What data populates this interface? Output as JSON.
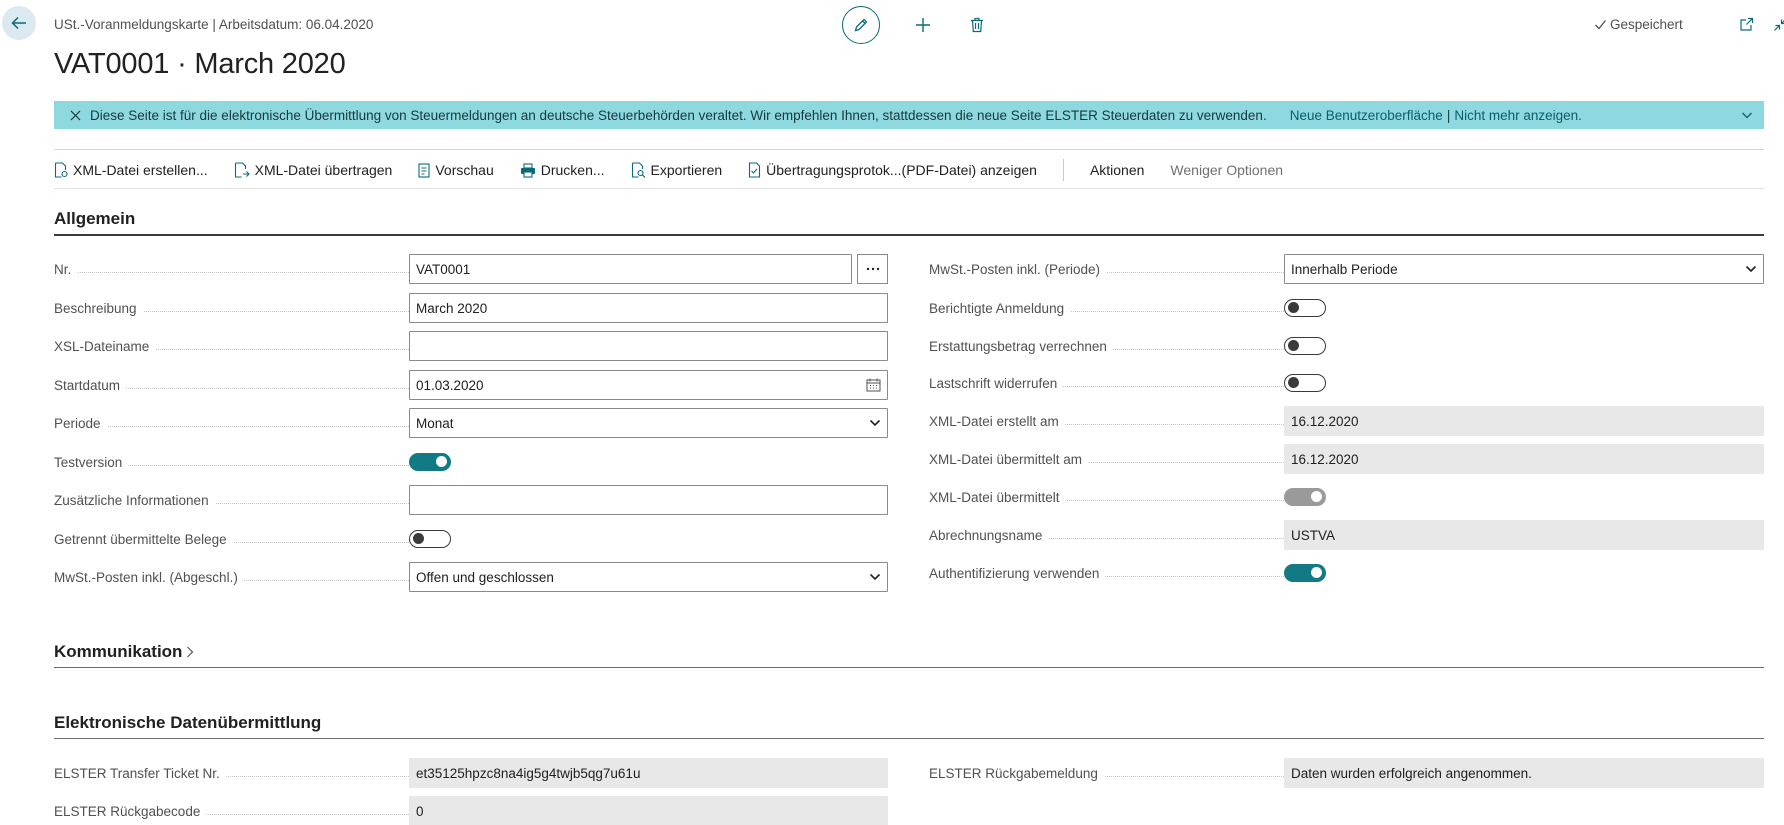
{
  "header": {
    "breadcrumb": "USt.-Voranmeldungskarte | Arbeitsdatum: 06.04.2020",
    "title": "VAT0001 · March 2020",
    "saved_status": "Gespeichert"
  },
  "banner": {
    "message": "Diese Seite ist für die elektronische Übermittlung von Steuermeldungen an deutsche Steuerbehörden veraltet. Wir empfehlen Ihnen, stattdessen die neue Seite ELSTER Steuerdaten zu verwenden.",
    "link_new_ui": "Neue Benutzeroberfläche",
    "separator": "|",
    "link_dont_show": "Nicht mehr anzeigen."
  },
  "actions": {
    "create_xml": "XML-Datei erstellen...",
    "transmit_xml": "XML-Datei übertragen",
    "preview": "Vorschau",
    "print": "Drucken...",
    "export": "Exportieren",
    "protocol": "Übertragungsprotok...(PDF-Datei) anzeigen",
    "actions_menu": "Aktionen",
    "fewer_options": "Weniger Optionen"
  },
  "general": {
    "section_title": "Allgemein",
    "left": {
      "no_label": "Nr.",
      "no_value": "VAT0001",
      "description_label": "Beschreibung",
      "description_value": "March 2020",
      "xsl_label": "XSL-Dateiname",
      "xsl_value": "",
      "start_label": "Startdatum",
      "start_value": "01.03.2020",
      "period_label": "Periode",
      "period_value": "Monat",
      "test_label": "Testversion",
      "test_on": true,
      "additional_label": "Zusätzliche Informationen",
      "additional_value": "",
      "separate_label": "Getrennt übermittelte Belege",
      "separate_on": false,
      "vat_closed_label": "MwSt.-Posten inkl. (Abgeschl.)",
      "vat_closed_value": "Offen und geschlossen"
    },
    "right": {
      "vat_period_label": "MwSt.-Posten inkl. (Periode)",
      "vat_period_value": "Innerhalb Periode",
      "corrected_label": "Berichtigte Anmeldung",
      "corrected_on": false,
      "refund_label": "Erstattungsbetrag verrechnen",
      "refund_on": false,
      "debit_label": "Lastschrift widerrufen",
      "debit_on": false,
      "xml_created_label": "XML-Datei erstellt am",
      "xml_created_value": "16.12.2020",
      "xml_sent_at_label": "XML-Datei übermittelt am",
      "xml_sent_at_value": "16.12.2020",
      "xml_sent_label": "XML-Datei übermittelt",
      "xml_sent_on": true,
      "billing_name_label": "Abrechnungsname",
      "billing_name_value": "USTVA",
      "auth_label": "Authentifizierung verwenden",
      "auth_on": true
    }
  },
  "communication": {
    "section_title": "Kommunikation"
  },
  "electronic": {
    "section_title": "Elektronische Datenübermittlung",
    "ticket_label": "ELSTER Transfer Ticket Nr.",
    "ticket_value": "et35125hpzc8na4ig5g4twjb5qg7u61u",
    "return_code_label": "ELSTER Rückgabecode",
    "return_code_value": "0",
    "return_msg_label": "ELSTER Rückgabemeldung",
    "return_msg_value": "Daten wurden erfolgreich angenommen."
  },
  "colors": {
    "accent": "#117a85",
    "banner": "#8ed8e0"
  }
}
